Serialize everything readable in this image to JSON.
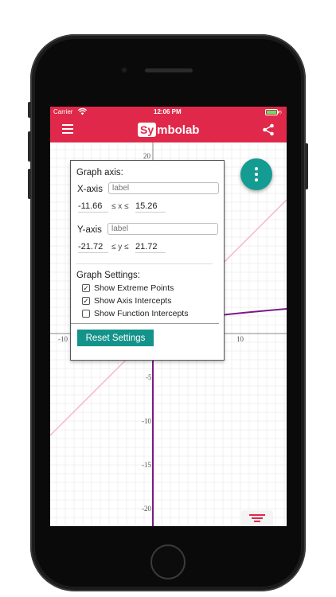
{
  "status": {
    "carrier": "Carrier",
    "time": "12:06 PM"
  },
  "app": {
    "brand_box": "Sy",
    "brand_rest": "mbolab"
  },
  "graph": {
    "tick_labels": {
      "x_left": "-10",
      "x_right": "10",
      "y_top": "20",
      "y_m5": "-5",
      "y_m10": "-10",
      "y_m15": "-15",
      "y_m20": "-20"
    },
    "colors": {
      "line": "#f7b8c6",
      "curve": "#7a1a86",
      "grid": "#e6e6e6",
      "axis": "#888888"
    }
  },
  "dialog": {
    "title": "Graph axis:",
    "x_axis_label": "X-axis",
    "x_axis_placeholder": "label",
    "x_min": "-11.66",
    "x_relation": "≤ x ≤",
    "x_max": "15.26",
    "y_axis_label": "Y-axis",
    "y_axis_placeholder": "label",
    "y_min": "-21.72",
    "y_relation": "≤ y ≤",
    "y_max": "21.72",
    "settings_title": "Graph Settings:",
    "options": [
      {
        "label": "Show Extreme Points",
        "checked": true
      },
      {
        "label": "Show Axis Intercepts",
        "checked": true
      },
      {
        "label": "Show Function Intercepts",
        "checked": false
      }
    ],
    "reset_label": "Reset Settings"
  },
  "colors": {
    "accent": "#e0294a",
    "teal": "#149c93"
  }
}
